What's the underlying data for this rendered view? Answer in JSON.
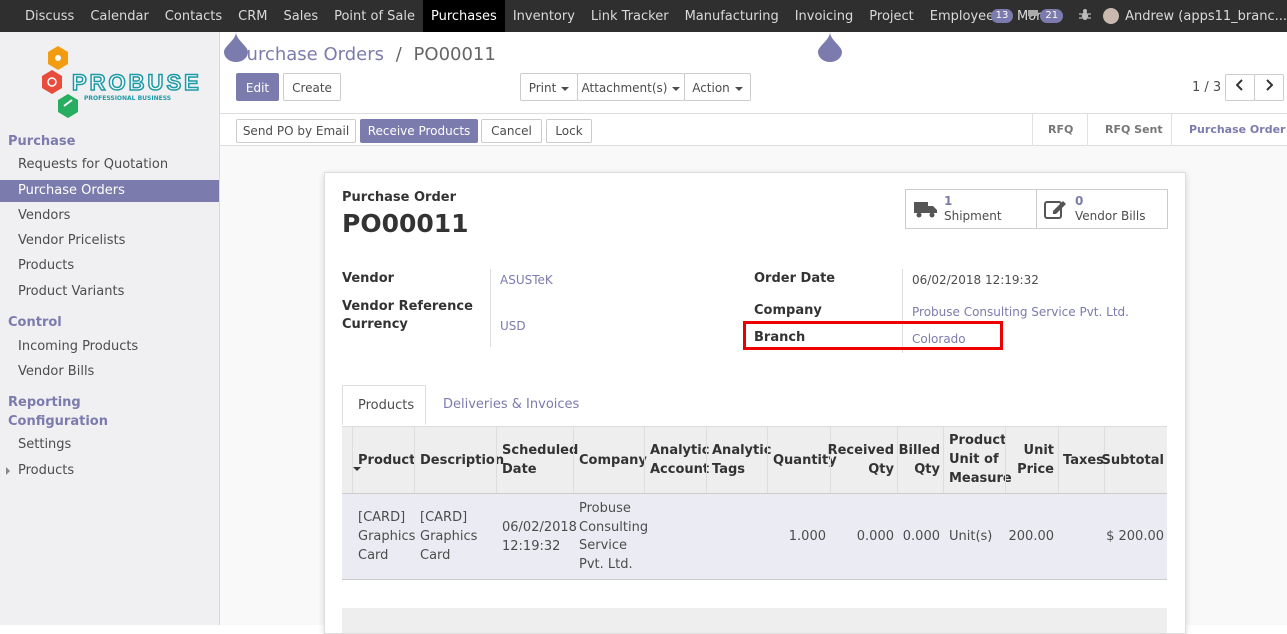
{
  "topnav": {
    "apps": [
      "Discuss",
      "Calendar",
      "Contacts",
      "CRM",
      "Sales",
      "Point of Sale",
      "Purchases",
      "Inventory",
      "Link Tracker",
      "Manufacturing",
      "Invoicing",
      "Project",
      "Employees"
    ],
    "more_label": "More",
    "active_app": "Purchases",
    "badge_activities": "13",
    "badge_messages": "21",
    "user": "Andrew (apps11_branc..."
  },
  "sidebar": {
    "logo_text": "PROBUSE",
    "logo_tagline": "PROFESSIONAL BUSINESS",
    "sections": {
      "purchase": "Purchase",
      "control": "Control",
      "reporting": "Reporting",
      "configuration": "Configuration"
    },
    "items": {
      "rfq": "Requests for Quotation",
      "po": "Purchase Orders",
      "vendors": "Vendors",
      "pricelists": "Vendor Pricelists",
      "products": "Products",
      "variants": "Product Variants",
      "incoming": "Incoming Products",
      "bills": "Vendor Bills",
      "settings": "Settings",
      "config_products": "Products"
    },
    "active_item": "Purchase Orders"
  },
  "control_panel": {
    "breadcrumb_parent": "Purchase Orders",
    "breadcrumb_sep": "/",
    "breadcrumb_current": "PO00011",
    "edit_label": "Edit",
    "create_label": "Create",
    "print_label": "Print",
    "attachments_label": "Attachment(s)",
    "action_label": "Action",
    "pager": "1 / 3"
  },
  "statusbar": {
    "buttons": {
      "send_email": "Send PO by Email",
      "receive": "Receive Products",
      "cancel": "Cancel",
      "lock": "Lock"
    },
    "stages": [
      "RFQ",
      "RFQ Sent",
      "Purchase Order"
    ],
    "current_stage": "Purchase Order"
  },
  "form": {
    "doc_type": "Purchase Order",
    "doc_name": "PO00011",
    "smart_buttons": {
      "shipment": {
        "count": "1",
        "label": "Shipment"
      },
      "bills": {
        "count": "0",
        "label": "Vendor Bills"
      }
    },
    "labels": {
      "vendor": "Vendor",
      "vendor_ref": "Vendor Reference",
      "currency": "Currency",
      "order_date": "Order Date",
      "company": "Company",
      "branch": "Branch"
    },
    "values": {
      "vendor": "ASUSTeK",
      "currency": "USD",
      "order_date": "06/02/2018 12:19:32",
      "company": "Probuse Consulting Service Pvt. Ltd.",
      "branch": "Colorado"
    },
    "tabs": {
      "products": "Products",
      "deliveries": "Deliveries & Invoices"
    },
    "table": {
      "headers": {
        "product": "Product",
        "description": "Description",
        "scheduled_1": "Scheduled",
        "scheduled_2": "Date",
        "company": "Company",
        "analytic_acc_1": "Analytic",
        "analytic_acc_2": "Account",
        "analytic_tags_1": "Analytic",
        "analytic_tags_2": "Tags",
        "quantity": "Quantity",
        "received_1": "Received",
        "received_2": "Qty",
        "billed_1": "Billed",
        "billed_2": "Qty",
        "uom_1": "Product",
        "uom_2": "Unit of",
        "uom_3": "Measure",
        "unit_price_1": "Unit",
        "unit_price_2": "Price",
        "taxes": "Taxes",
        "subtotal": "Subtotal"
      },
      "row": {
        "product": [
          "[CARD]",
          "Graphics",
          "Card"
        ],
        "description": [
          "[CARD]",
          "Graphics",
          "Card"
        ],
        "scheduled": [
          "06/02/2018",
          "12:19:32"
        ],
        "company": [
          "Probuse",
          "Consulting",
          "Service",
          "Pvt. Ltd."
        ],
        "quantity": "1.000",
        "received": "0.000",
        "billed": "0.000",
        "uom": "Unit(s)",
        "unit_price": "200.00",
        "subtotal": "$ 200.00"
      }
    }
  }
}
